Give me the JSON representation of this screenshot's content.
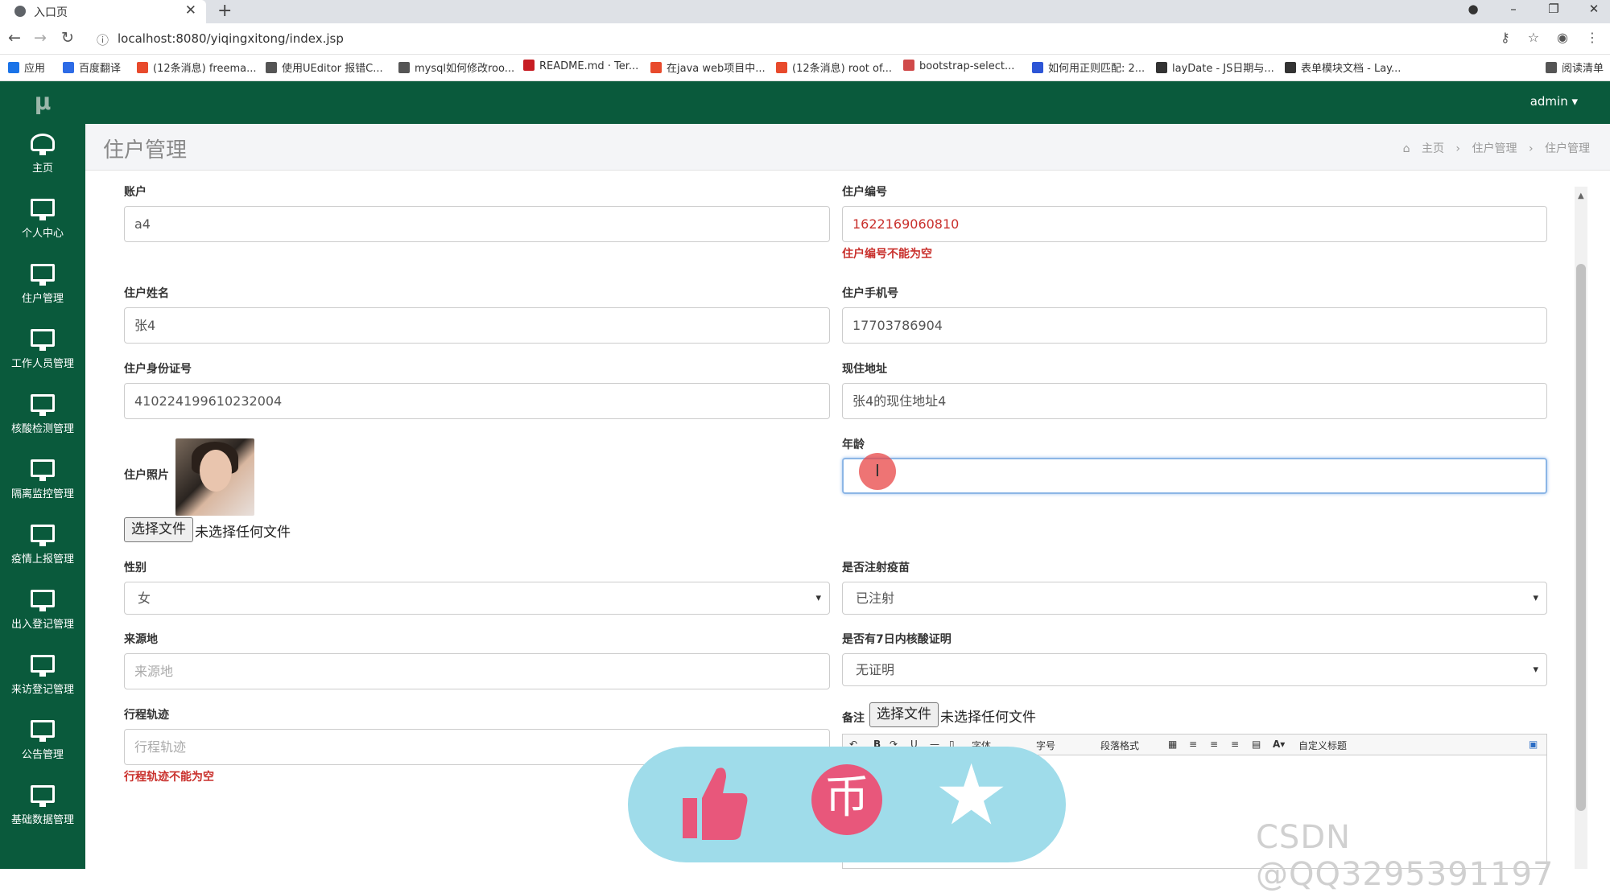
{
  "browser": {
    "tab_title": "入口页",
    "url": "localhost:8080/yiqingxitong/index.jsp",
    "bookmarks": [
      {
        "label": "应用",
        "icon": "apps-grid-icon",
        "color": "#1a73e8"
      },
      {
        "label": "百度翻译",
        "icon": "baidu-translate-icon",
        "color": "#2d6be6"
      },
      {
        "label": "(12条消息) freema...",
        "icon": "csdn-icon",
        "color": "#e84a2c"
      },
      {
        "label": "使用UEditor 报错C...",
        "icon": "bird-icon",
        "color": "#555"
      },
      {
        "label": "mysql如何修改roo...",
        "icon": "bird-icon",
        "color": "#555"
      },
      {
        "label": "README.md · Ter...",
        "icon": "gitee-icon",
        "color": "#c71d23"
      },
      {
        "label": "在java web项目中...",
        "icon": "csdn-icon",
        "color": "#e84a2c"
      },
      {
        "label": "(12条消息) root of...",
        "icon": "csdn-icon",
        "color": "#e84a2c"
      },
      {
        "label": "bootstrap-select...",
        "icon": "page-icon",
        "color": "#d04a4a"
      },
      {
        "label": "如何用正则匹配: 2...",
        "icon": "baidu-icon",
        "color": "#2d55d6"
      },
      {
        "label": "layDate - JS日期与...",
        "icon": "layui-icon",
        "color": "#333"
      },
      {
        "label": "表单模块文档 - Lay...",
        "icon": "layui-icon",
        "color": "#333"
      },
      {
        "label": "阅读清单",
        "icon": "reading-list-icon",
        "color": "#555"
      }
    ]
  },
  "app": {
    "logo": "μ",
    "user": "admin ▾",
    "sidebar": [
      {
        "label": "主页",
        "icon": "dashboard-icon"
      },
      {
        "label": "个人中心",
        "icon": "monitor-icon"
      },
      {
        "label": "住户管理",
        "icon": "monitor-icon"
      },
      {
        "label": "工作人员管理",
        "icon": "monitor-icon"
      },
      {
        "label": "核酸检测管理",
        "icon": "monitor-icon"
      },
      {
        "label": "隔离监控管理",
        "icon": "monitor-icon"
      },
      {
        "label": "疫情上报管理",
        "icon": "monitor-icon"
      },
      {
        "label": "出入登记管理",
        "icon": "monitor-icon"
      },
      {
        "label": "来访登记管理",
        "icon": "monitor-icon"
      },
      {
        "label": "公告管理",
        "icon": "monitor-icon"
      },
      {
        "label": "基础数据管理",
        "icon": "monitor-icon"
      }
    ],
    "page_title": "住户管理",
    "breadcrumb": [
      "主页",
      "›",
      "住户管理",
      "›",
      "住户管理"
    ]
  },
  "form": {
    "account_label": "账户",
    "account_value": "a4",
    "resident_no_label": "住户编号",
    "resident_no_value": "1622169060810",
    "resident_no_error": "住户编号不能为空",
    "name_label": "住户姓名",
    "name_value": "张4",
    "phone_label": "住户手机号",
    "phone_value": "17703786904",
    "idcard_label": "住户身份证号",
    "idcard_value": "410224199610232004",
    "address_label": "现住地址",
    "address_value": "张4的现住地址4",
    "photo_label": "住户照片",
    "age_label": "年龄",
    "age_value": "",
    "file_button": "选择文件",
    "file_none": "未选择任何文件",
    "gender_label": "性别",
    "gender_value": "女",
    "vaccine_label": "是否注射疫苗",
    "vaccine_value": "已注射",
    "origin_label": "来源地",
    "origin_placeholder": "来源地",
    "nucleic_label": "是否有7日内核酸证明",
    "nucleic_value": "无证明",
    "trip_label": "行程轨迹",
    "trip_placeholder": "行程轨迹",
    "trip_error": "行程轨迹不能为空",
    "remark_label": "备注",
    "editor_toolbar": [
      "字体",
      "字号",
      "段落格式",
      "自定义标题"
    ]
  },
  "overlay": {
    "coin_glyph": "币"
  },
  "watermark": "CSDN @QQ3295391197"
}
